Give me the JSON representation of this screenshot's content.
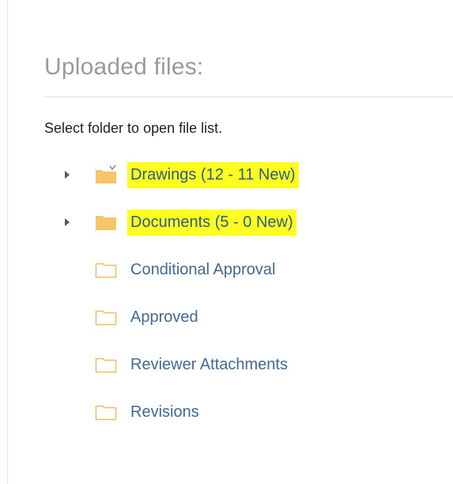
{
  "title": "Uploaded files:",
  "instruction": "Select folder to open file list.",
  "colors": {
    "highlight": "#ffff1f",
    "folder_fill": "#f7c46a",
    "link": "#3f6a95"
  },
  "folders": [
    {
      "label": "Drawings (12 - 11 New)",
      "icon": "folder-filled-open-icon",
      "expandable": true,
      "highlighted": true
    },
    {
      "label": "Documents (5 - 0 New)",
      "icon": "folder-filled-icon",
      "expandable": true,
      "highlighted": true
    },
    {
      "label": "Conditional Approval",
      "icon": "folder-outline-icon",
      "expandable": false,
      "highlighted": false
    },
    {
      "label": "Approved",
      "icon": "folder-outline-icon",
      "expandable": false,
      "highlighted": false
    },
    {
      "label": "Reviewer Attachments",
      "icon": "folder-outline-icon",
      "expandable": false,
      "highlighted": false
    },
    {
      "label": "Revisions",
      "icon": "folder-outline-icon",
      "expandable": false,
      "highlighted": false
    }
  ]
}
